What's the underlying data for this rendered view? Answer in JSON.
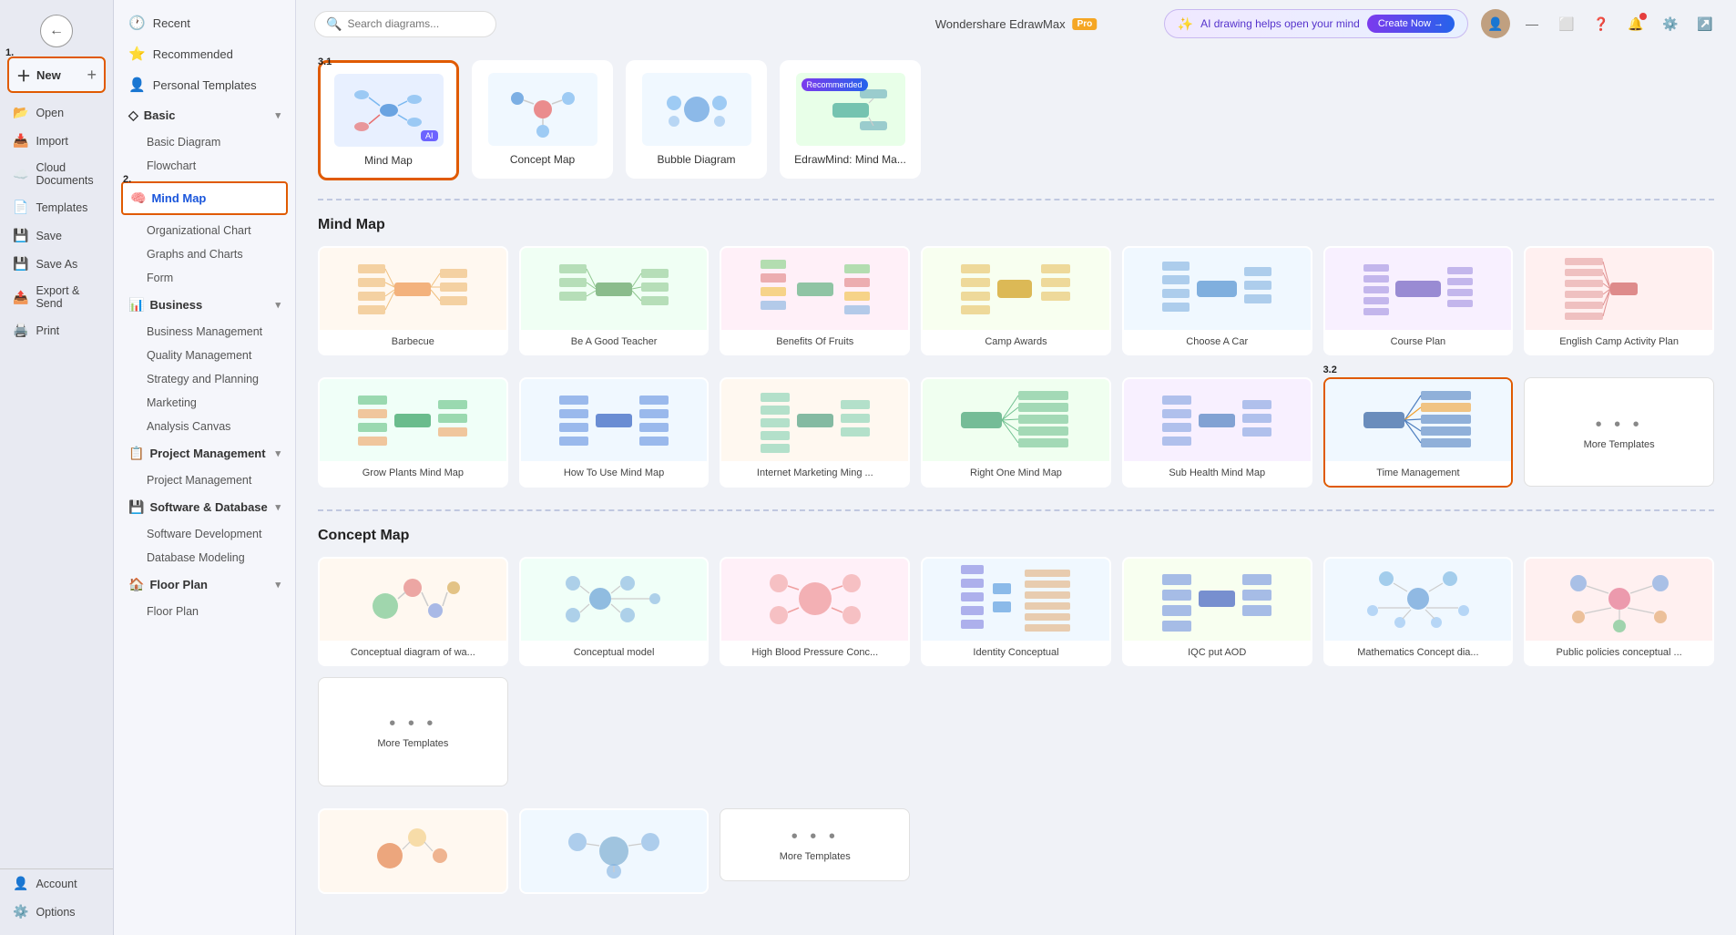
{
  "app": {
    "title": "Wondershare EdrawMax",
    "pro_badge": "Pro",
    "step1_label": "1.",
    "step2_label": "2.",
    "step3_1_label": "3.1",
    "step3_2_label": "3.2"
  },
  "left_panel": {
    "back_label": "←",
    "new_label": "New",
    "new_plus": "+",
    "open_label": "Open",
    "import_label": "Import",
    "cloud_label": "Cloud Documents",
    "templates_label": "Templates",
    "save_label": "Save",
    "save_as_label": "Save As",
    "export_label": "Export & Send",
    "print_label": "Print",
    "account_label": "Account",
    "options_label": "Options"
  },
  "sidebar": {
    "recent_label": "Recent",
    "recommended_label": "Recommended",
    "personal_label": "Personal Templates",
    "categories": [
      {
        "id": "basic",
        "label": "Basic",
        "icon": "◇",
        "expanded": true,
        "items": [
          "Basic Diagram",
          "Flowchart"
        ]
      },
      {
        "id": "mindmap",
        "label": "Mind Map",
        "icon": "🧠",
        "active": true,
        "items": [
          "Organizational Chart",
          "Graphs and Charts",
          "Form"
        ]
      },
      {
        "id": "business",
        "label": "Business",
        "icon": "📊",
        "expanded": true,
        "items": [
          "Business Management",
          "Quality Management",
          "Strategy and Planning",
          "Marketing",
          "Analysis Canvas"
        ]
      },
      {
        "id": "project",
        "label": "Project Management",
        "icon": "📋",
        "expanded": true,
        "items": [
          "Project Management"
        ]
      },
      {
        "id": "software",
        "label": "Software & Database",
        "icon": "💾",
        "expanded": true,
        "items": [
          "Software Development",
          "Database Modeling"
        ]
      },
      {
        "id": "floor",
        "label": "Floor Plan",
        "icon": "🏠",
        "expanded": true,
        "items": [
          "Floor Plan"
        ]
      }
    ]
  },
  "search": {
    "placeholder": "Search diagrams..."
  },
  "ai_banner": {
    "text": "AI drawing helps open your mind",
    "button_label": "Create Now →"
  },
  "top_templates": [
    {
      "id": "mindmap",
      "label": "Mind Map",
      "selected": true,
      "color": "#e8f0ff"
    },
    {
      "id": "concept",
      "label": "Concept Map",
      "selected": false,
      "color": "#f0f8ff"
    },
    {
      "id": "bubble",
      "label": "Bubble Diagram",
      "selected": false,
      "color": "#f0f8ff"
    },
    {
      "id": "edrawmind",
      "label": "EdrawMind: Mind Ma...",
      "selected": false,
      "color": "#e8ffe8",
      "recommended": true
    }
  ],
  "mind_map_section": {
    "title": "Mind Map",
    "templates": [
      {
        "id": "barbecue",
        "label": "Barbecue",
        "color": "#fff8f0"
      },
      {
        "id": "good-teacher",
        "label": "Be A Good Teacher",
        "color": "#f0fff4"
      },
      {
        "id": "benefits-fruits",
        "label": "Benefits Of Fruits",
        "color": "#fff0f8"
      },
      {
        "id": "camp-awards",
        "label": "Camp Awards",
        "color": "#f8fff0"
      },
      {
        "id": "choose-car",
        "label": "Choose A Car",
        "color": "#f0f8ff"
      },
      {
        "id": "course-plan",
        "label": "Course Plan",
        "color": "#f8f0ff"
      },
      {
        "id": "english-camp",
        "label": "English Camp Activity Plan",
        "color": "#fff0f0"
      },
      {
        "id": "grow-plants",
        "label": "Grow Plants Mind Map",
        "color": "#f0fff8"
      },
      {
        "id": "how-to-use",
        "label": "How To Use Mind Map",
        "color": "#f0f8ff"
      },
      {
        "id": "internet-marketing",
        "label": "Internet Marketing Ming ...",
        "color": "#fff8f0"
      },
      {
        "id": "right-one",
        "label": "Right One Mind Map",
        "color": "#f0fff0"
      },
      {
        "id": "sub-health",
        "label": "Sub Health Mind Map",
        "color": "#f8f0ff"
      },
      {
        "id": "time-mgmt",
        "label": "Time Management",
        "color": "#f0f8ff",
        "selected": true
      },
      {
        "id": "more-mm",
        "label": "More Templates",
        "is_more": true
      }
    ]
  },
  "concept_map_section": {
    "title": "Concept Map",
    "templates": [
      {
        "id": "conceptual-wa",
        "label": "Conceptual diagram of wa...",
        "color": "#fff8f0"
      },
      {
        "id": "conceptual-model",
        "label": "Conceptual model",
        "color": "#f0fff8"
      },
      {
        "id": "high-blood",
        "label": "High Blood Pressure Conc...",
        "color": "#fff0f8"
      },
      {
        "id": "identity",
        "label": "Identity Conceptual",
        "color": "#f0f8ff"
      },
      {
        "id": "iqc-aod",
        "label": "IQC put AOD",
        "color": "#f8fff0"
      },
      {
        "id": "math-concept",
        "label": "Mathematics Concept dia...",
        "color": "#f0f8ff"
      },
      {
        "id": "public-policies",
        "label": "Public policies conceptual ...",
        "color": "#fff0f0"
      },
      {
        "id": "more-cm1",
        "label": "More Templates",
        "is_more": false
      },
      {
        "id": "more-cm2",
        "label": "More Templates",
        "is_more": true
      }
    ]
  },
  "window_buttons": {
    "minimize": "—",
    "maximize": "⬜",
    "close": "✕"
  }
}
